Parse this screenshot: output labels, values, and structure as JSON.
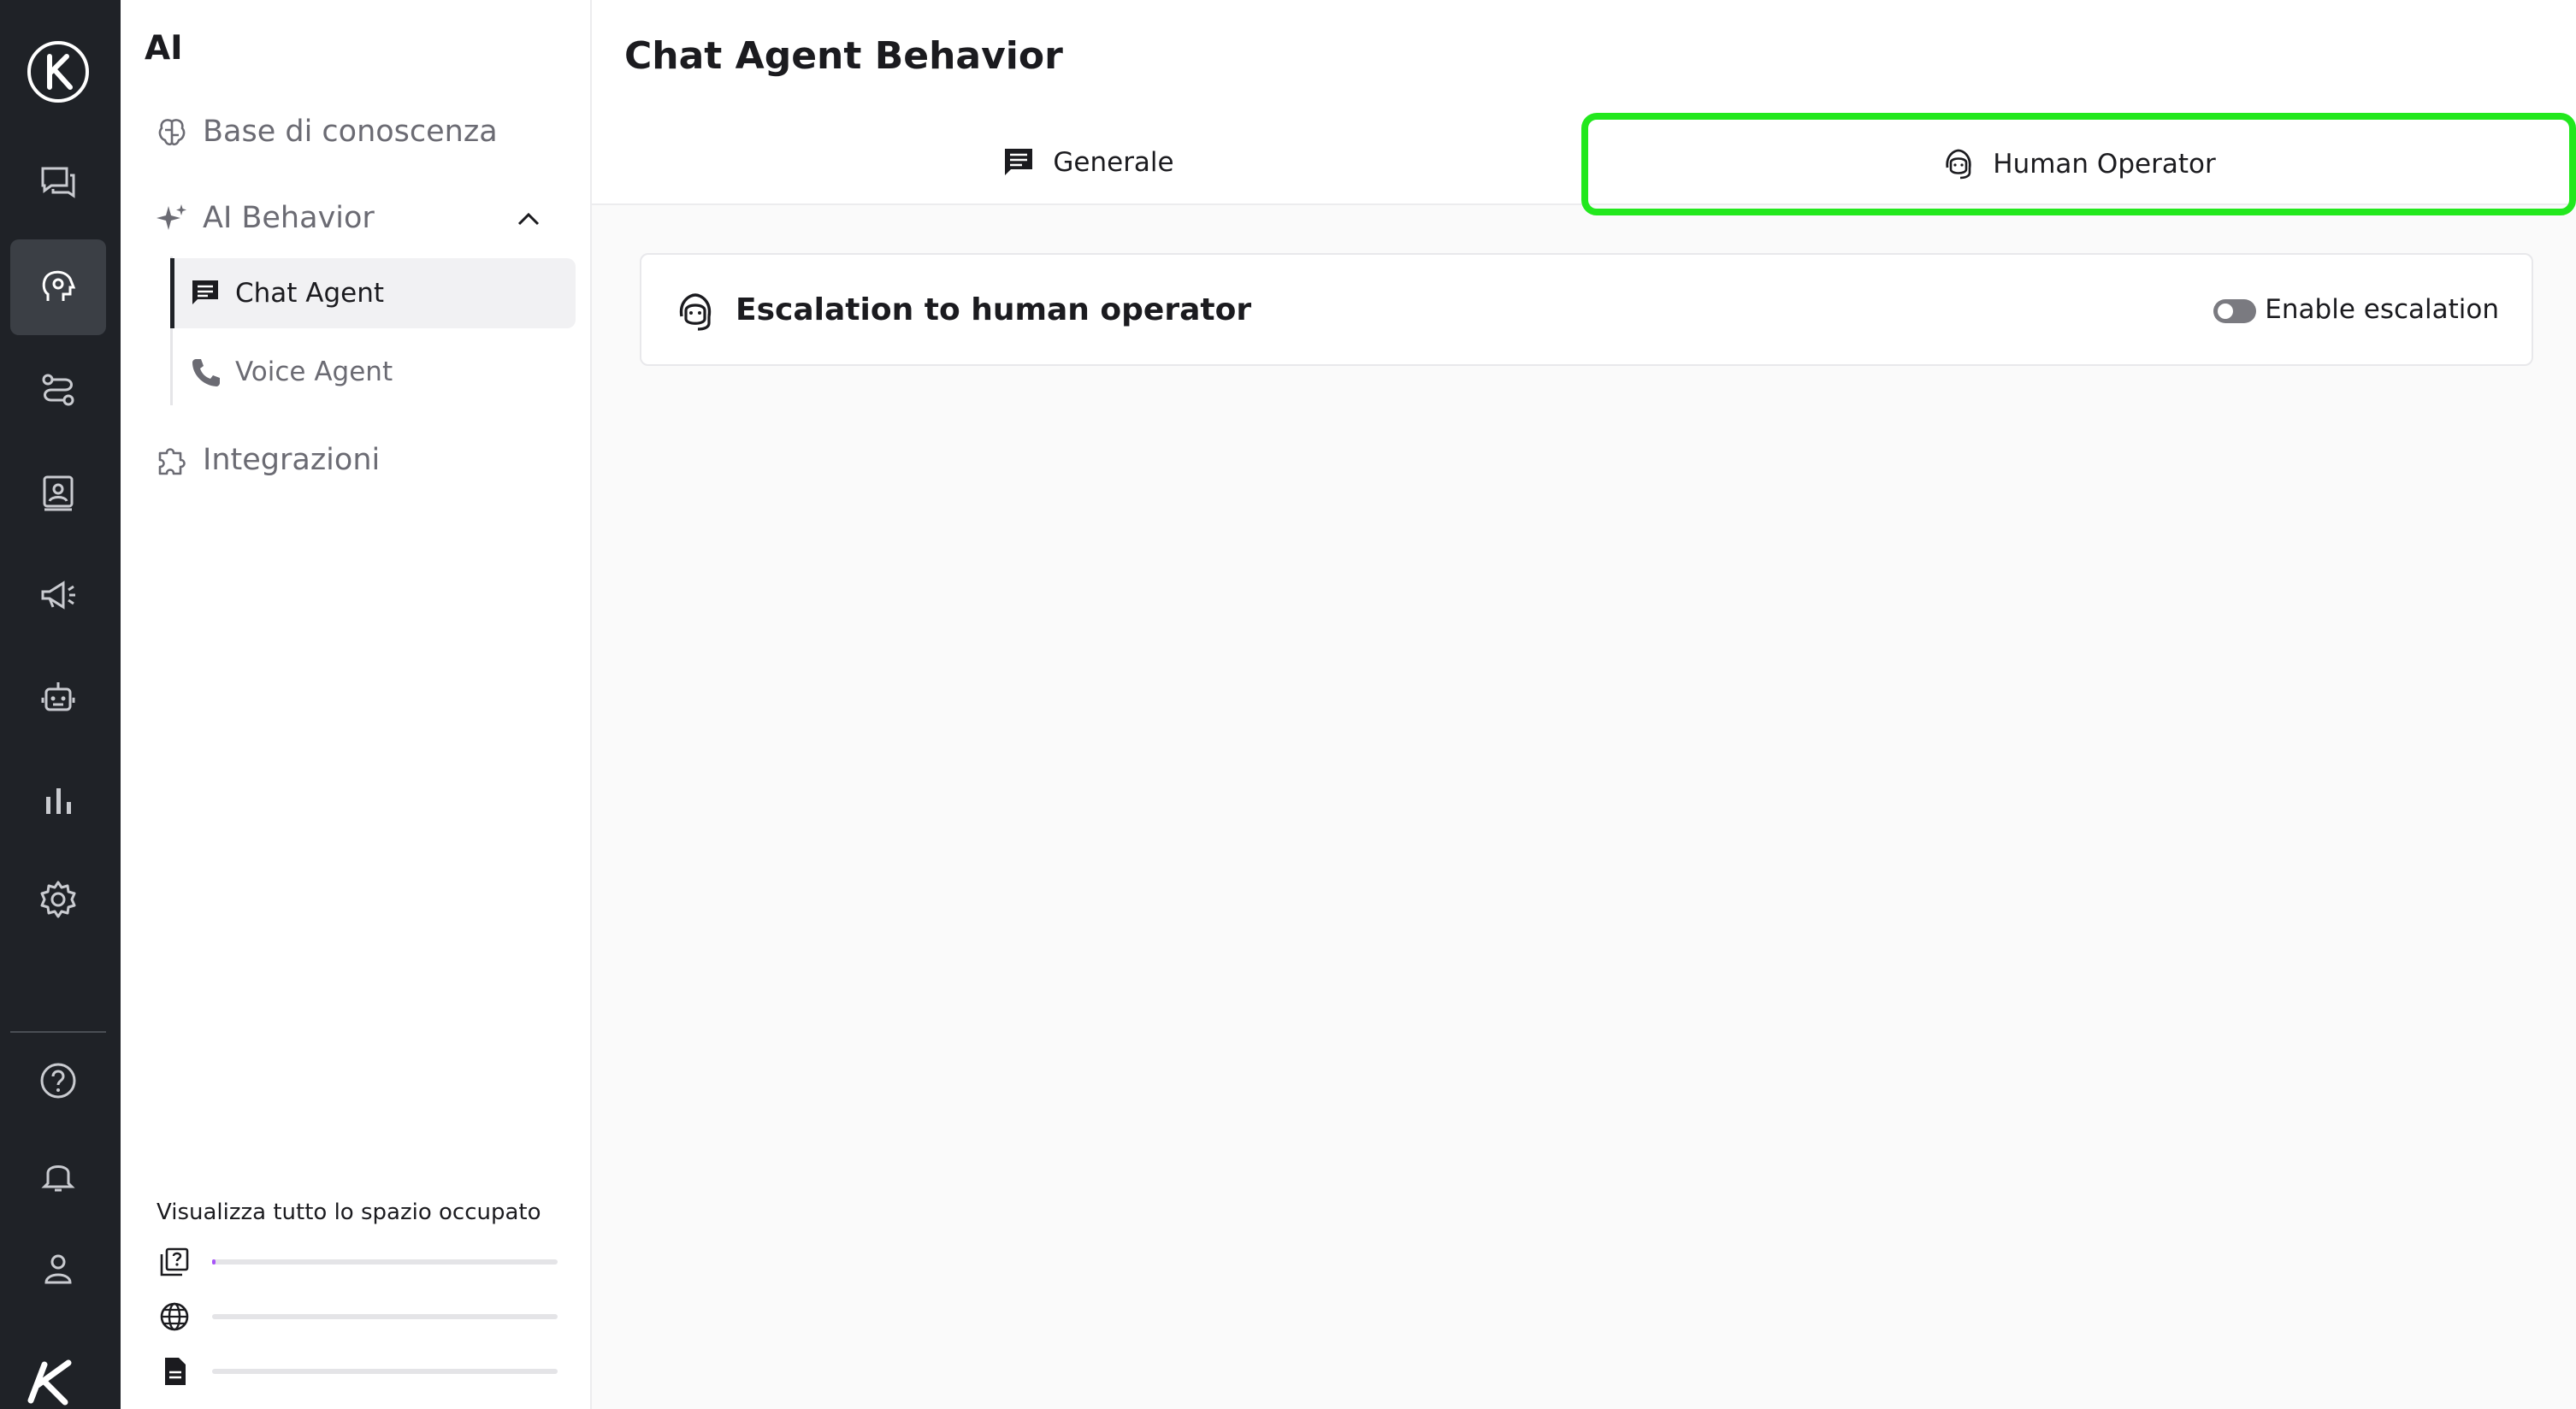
{
  "sidebar": {
    "title": "AI",
    "items": [
      {
        "label": "Base di conoscenza",
        "icon": "brain-icon"
      },
      {
        "label": "AI Behavior",
        "icon": "sparkle-icon"
      },
      {
        "label": "Integrazioni",
        "icon": "puzzle-icon"
      }
    ],
    "sub_items": [
      {
        "label": "Chat Agent",
        "icon": "chat-icon"
      },
      {
        "label": "Voice Agent",
        "icon": "phone-icon"
      }
    ],
    "storage": {
      "label": "Visualizza tutto lo spazio occupato",
      "rows": [
        {
          "icon": "faq-icon",
          "usage": 0.01
        },
        {
          "icon": "globe-icon",
          "usage": 0
        },
        {
          "icon": "document-icon",
          "usage": 0
        }
      ]
    }
  },
  "main": {
    "title": "Chat Agent Behavior",
    "tabs": [
      {
        "label": "Generale",
        "icon": "chat-icon"
      },
      {
        "label": "Human Operator",
        "icon": "headset-icon"
      }
    ],
    "card": {
      "title": "Escalation to human operator",
      "toggle_label": "Enable escalation",
      "toggle_on": false
    }
  },
  "colors": {
    "rail_bg": "#1f2227",
    "highlight": "#22e81d",
    "storage_fill": "#a855f7"
  }
}
